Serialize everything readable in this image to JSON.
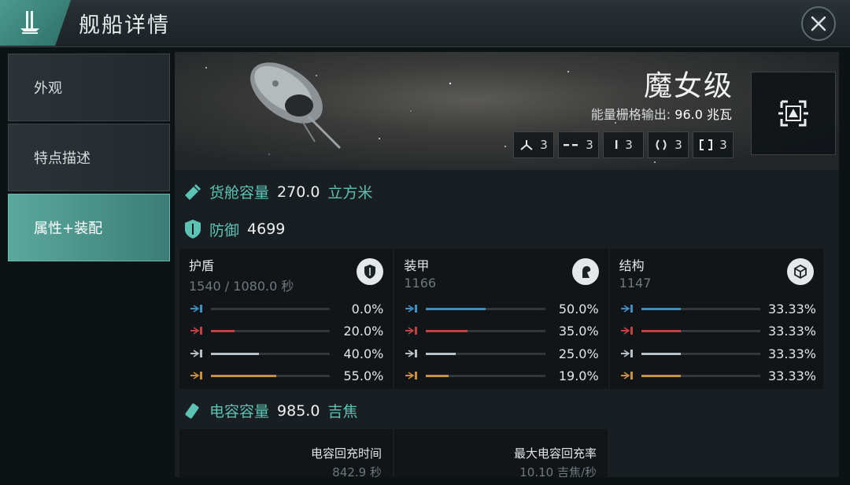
{
  "header": {
    "title": "舰船详情"
  },
  "sidebar": {
    "items": [
      {
        "label": "外观",
        "active": false
      },
      {
        "label": "特点描述",
        "active": false
      },
      {
        "label": "属性+装配",
        "active": true
      }
    ]
  },
  "ship": {
    "name": "魔女级",
    "powergrid_label": "能量栅格输出:",
    "powergrid_value": "96.0",
    "powergrid_unit": "兆瓦",
    "slots": [
      {
        "icon": "turret-hardpoint-icon",
        "count": "3"
      },
      {
        "icon": "dashed-slot-icon",
        "count": "3"
      },
      {
        "icon": "single-bar-slot-icon",
        "count": "3"
      },
      {
        "icon": "parentheses-slot-icon",
        "count": "3"
      },
      {
        "icon": "brackets-slot-icon",
        "count": "3"
      }
    ]
  },
  "cargo": {
    "label": "货舱容量",
    "value": "270.0",
    "unit": "立方米"
  },
  "defense": {
    "label": "防御",
    "value": "4699",
    "panels": [
      {
        "title": "护盾",
        "sub": "1540 / 1080.0 秒",
        "icon": "shield-icon",
        "resists": [
          {
            "pct": "0.0%",
            "f": 0.0
          },
          {
            "pct": "20.0%",
            "f": 0.2
          },
          {
            "pct": "40.0%",
            "f": 0.4
          },
          {
            "pct": "55.0%",
            "f": 0.55
          }
        ]
      },
      {
        "title": "装甲",
        "sub": "1166",
        "icon": "armor-icon",
        "resists": [
          {
            "pct": "50.0%",
            "f": 0.5
          },
          {
            "pct": "35.0%",
            "f": 0.35
          },
          {
            "pct": "25.0%",
            "f": 0.25
          },
          {
            "pct": "19.0%",
            "f": 0.19
          }
        ]
      },
      {
        "title": "结构",
        "sub": "1147",
        "icon": "structure-cube-icon",
        "resists": [
          {
            "pct": "33.33%",
            "f": 0.3333
          },
          {
            "pct": "33.33%",
            "f": 0.3333
          },
          {
            "pct": "33.33%",
            "f": 0.3333
          },
          {
            "pct": "33.33%",
            "f": 0.3333
          }
        ]
      }
    ]
  },
  "damage_colors": {
    "em": "#3f8fc4",
    "thermal": "#c04343",
    "kinetic": "#b8c2c8",
    "explosive": "#c9913d"
  },
  "capacitor": {
    "label": "电容容量",
    "value": "985.0",
    "unit": "吉焦",
    "panels": [
      {
        "label": "电容回充时间",
        "value": "842.9 秒"
      },
      {
        "label": "最大电容回充率",
        "value": "10.10 吉焦/秒"
      }
    ]
  },
  "colors": {
    "accent": "#5cc3b4",
    "tab_active": "#4f9c91"
  }
}
